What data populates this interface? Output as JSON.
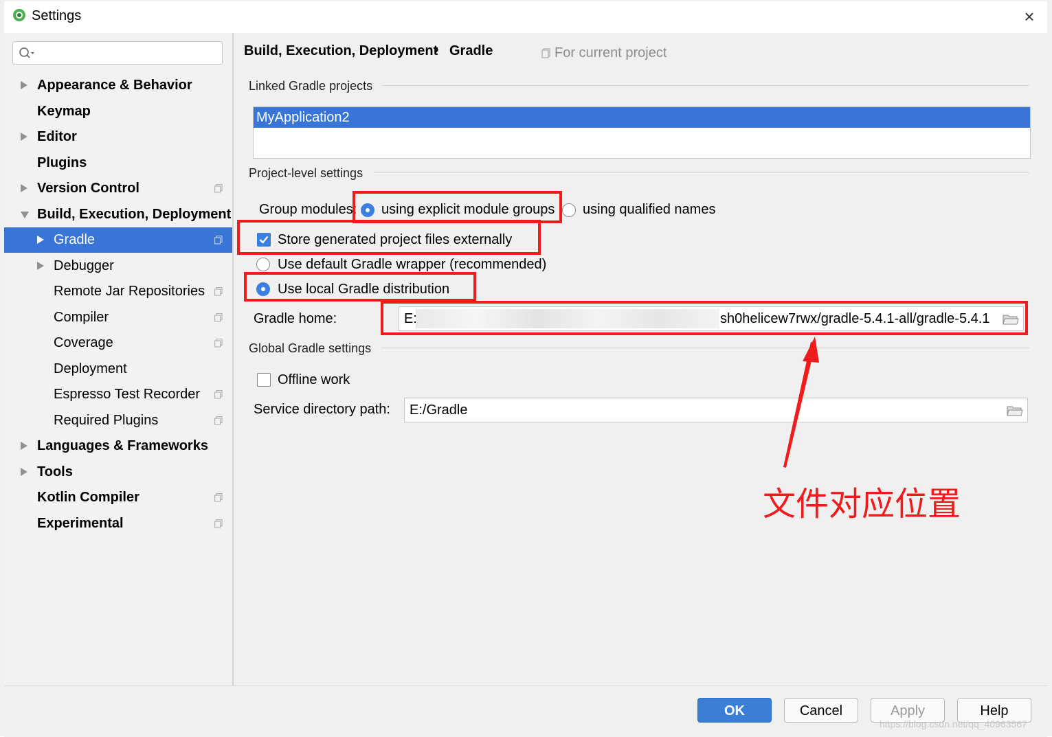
{
  "window": {
    "title": "Settings",
    "close_icon": "×"
  },
  "sidebar": {
    "search_placeholder": "",
    "items": [
      {
        "label": "Appearance & Behavior",
        "arrow": "right"
      },
      {
        "label": "Keymap"
      },
      {
        "label": "Editor",
        "arrow": "right"
      },
      {
        "label": "Plugins"
      },
      {
        "label": "Version Control",
        "arrow": "right",
        "project_icon": true
      },
      {
        "label": "Build, Execution, Deployment",
        "arrow": "down"
      },
      {
        "label": "Gradle",
        "arrow": "right",
        "selected": true,
        "project_icon": true
      },
      {
        "label": "Debugger",
        "arrow": "right"
      },
      {
        "label": "Remote Jar Repositories",
        "project_icon": true
      },
      {
        "label": "Compiler",
        "project_icon": true
      },
      {
        "label": "Coverage",
        "project_icon": true
      },
      {
        "label": "Deployment"
      },
      {
        "label": "Espresso Test Recorder",
        "project_icon": true
      },
      {
        "label": "Required Plugins",
        "project_icon": true
      },
      {
        "label": "Languages & Frameworks",
        "arrow": "right"
      },
      {
        "label": "Tools",
        "arrow": "right"
      },
      {
        "label": "Kotlin Compiler",
        "project_icon": true
      },
      {
        "label": "Experimental",
        "project_icon": true
      }
    ]
  },
  "breadcrumb": {
    "parent": "Build, Execution, Deployment",
    "separator": "›",
    "current": "Gradle",
    "scope_note": "For current project"
  },
  "linked_projects": {
    "title": "Linked Gradle projects",
    "items": [
      "MyApplication2"
    ]
  },
  "project_level": {
    "title": "Project-level settings",
    "group_modules_label": "Group modules:",
    "option_explicit": "using explicit module groups",
    "option_qualified": "using qualified names",
    "group_modules_selected": "using explicit module groups",
    "store_externally": {
      "label": "Store generated project files externally",
      "checked": true
    },
    "wrapper_option": "Use default Gradle wrapper (recommended)",
    "local_option": "Use local Gradle distribution",
    "distribution_selected": "Use local Gradle distribution",
    "gradle_home_label": "Gradle home:",
    "gradle_home_prefix": "E:/",
    "gradle_home_suffix": "sh0helicew7rwx/gradle-5.4.1-all/gradle-5.4.1"
  },
  "global": {
    "title": "Global Gradle settings",
    "offline_label": "Offline work",
    "offline_checked": false,
    "service_dir_label": "Service directory path:",
    "service_dir_value": "E:/Gradle"
  },
  "annotation": {
    "text": "文件对应位置",
    "color": "#ee1c1c"
  },
  "buttons": {
    "ok": "OK",
    "cancel": "Cancel",
    "apply": "Apply",
    "help": "Help"
  },
  "watermark": "https://blog.csdn.net/qq_40963567",
  "colors": {
    "selection": "#3875d7",
    "primary_button": "#3a7fd5",
    "annotation": "#ee1c1c"
  }
}
